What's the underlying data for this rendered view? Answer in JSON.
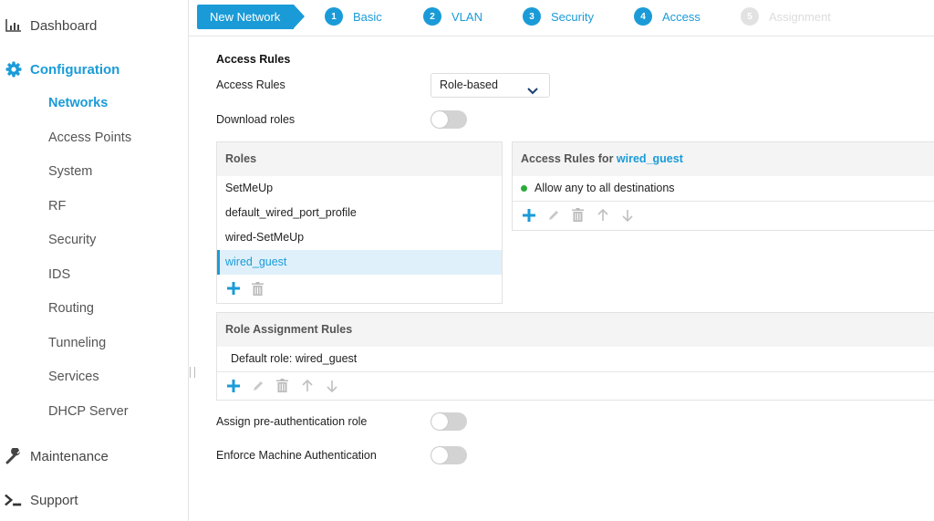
{
  "sidebar": {
    "top_items": [
      {
        "label": "Dashboard",
        "icon": "bar-chart-icon"
      },
      {
        "label": "Configuration",
        "icon": "gear-icon",
        "active": true
      },
      {
        "label": "Maintenance",
        "icon": "wrench-icon"
      },
      {
        "label": "Support",
        "icon": "terminal-icon"
      }
    ],
    "config_items": [
      {
        "label": "Networks",
        "active": true
      },
      {
        "label": "Access Points"
      },
      {
        "label": "System"
      },
      {
        "label": "RF"
      },
      {
        "label": "Security"
      },
      {
        "label": "IDS"
      },
      {
        "label": "Routing"
      },
      {
        "label": "Tunneling"
      },
      {
        "label": "Services"
      },
      {
        "label": "DHCP Server"
      }
    ]
  },
  "wizard": {
    "title": "New Network",
    "steps": [
      {
        "num": "1",
        "label": "Basic",
        "state": "done"
      },
      {
        "num": "2",
        "label": "VLAN",
        "state": "done"
      },
      {
        "num": "3",
        "label": "Security",
        "state": "done"
      },
      {
        "num": "4",
        "label": "Access",
        "state": "current"
      },
      {
        "num": "5",
        "label": "Assignment",
        "state": "disabled"
      }
    ]
  },
  "main": {
    "section_title": "Access Rules",
    "access_rules_label": "Access Rules",
    "access_rules_value": "Role-based",
    "download_roles_label": "Download roles",
    "download_roles_on": false,
    "roles_panel": {
      "title": "Roles",
      "items": [
        "SetMeUp",
        "default_wired_port_profile",
        "wired-SetMeUp",
        "wired_guest"
      ],
      "selected": "wired_guest"
    },
    "access_rules_panel": {
      "title_prefix": "Access Rules for",
      "role": "wired_guest",
      "rules": [
        {
          "text": "Allow any to all destinations",
          "status_color": "#2bab3a"
        }
      ]
    },
    "role_assignment_panel": {
      "title": "Role Assignment Rules",
      "rows": [
        "Default role: wired_guest"
      ]
    },
    "pre_auth_label": "Assign pre-authentication role",
    "pre_auth_on": false,
    "machine_auth_label": "Enforce Machine Authentication",
    "machine_auth_on": false
  },
  "colors": {
    "accent": "#1a9bd8",
    "disabled": "#dcdcdc",
    "ok": "#2bab3a"
  }
}
